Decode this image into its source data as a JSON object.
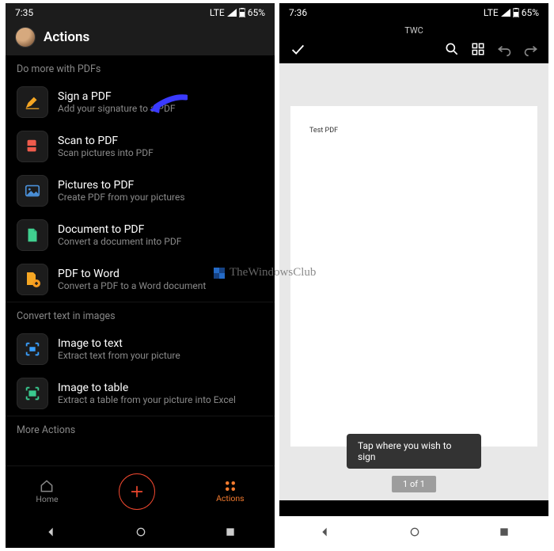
{
  "left": {
    "status": {
      "time": "7:35",
      "net": "LTE",
      "battery": "65%"
    },
    "header": {
      "title": "Actions"
    },
    "section1": "Do more with PDFs",
    "actions1": [
      {
        "title": "Sign a PDF",
        "sub": "Add your signature to a PDF",
        "icon": "pen",
        "color": "#f5a623"
      },
      {
        "title": "Scan to PDF",
        "sub": "Scan pictures into PDF",
        "icon": "scan",
        "color": "#ef5b4c"
      },
      {
        "title": "Pictures to PDF",
        "sub": "Create PDF from your pictures",
        "icon": "picture",
        "color": "#4a90d9"
      },
      {
        "title": "Document to PDF",
        "sub": "Convert a document into PDF",
        "icon": "doc",
        "color": "#40cf8f"
      },
      {
        "title": "PDF to Word",
        "sub": "Convert a PDF to a Word document",
        "icon": "pdfword",
        "color": "#f5a623"
      }
    ],
    "section2": "Convert text in images",
    "actions2": [
      {
        "title": "Image to text",
        "sub": "Extract text from your picture",
        "icon": "imgtext",
        "color": "#3aa0ff"
      },
      {
        "title": "Image to table",
        "sub": "Extract a table from your picture into Excel",
        "icon": "imgtable",
        "color": "#3ac98f"
      }
    ],
    "section3": "More Actions",
    "tabs": {
      "home": "Home",
      "actions": "Actions"
    }
  },
  "right": {
    "status": {
      "time": "7:36",
      "net": "LTE",
      "battery": "65%"
    },
    "docTitle": "TWC",
    "pdfText": "Test PDF",
    "toast": "Tap where you wish to sign",
    "pager": "1 of 1"
  },
  "watermark": "TheWindowsClub"
}
